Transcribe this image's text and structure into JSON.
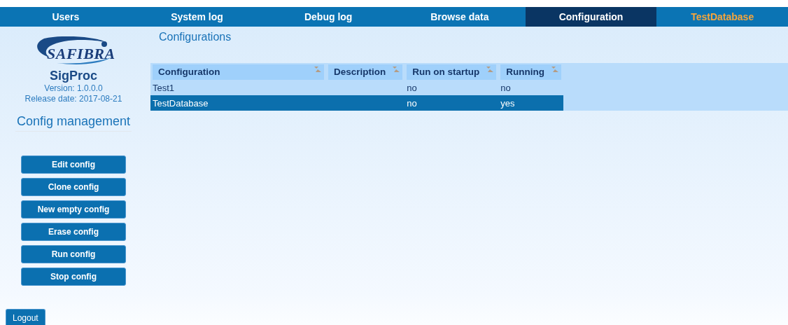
{
  "nav_tabs": [
    {
      "label": "Users",
      "selected": false,
      "kind": "page"
    },
    {
      "label": "System log",
      "selected": false,
      "kind": "page"
    },
    {
      "label": "Debug log",
      "selected": false,
      "kind": "page"
    },
    {
      "label": "Browse data",
      "selected": false,
      "kind": "page"
    },
    {
      "label": "Configuration",
      "selected": true,
      "kind": "page"
    },
    {
      "label": "TestDatabase",
      "selected": false,
      "kind": "highlight"
    }
  ],
  "sidebar": {
    "logo_text": "SAFIBRA",
    "app_name": "SigProc",
    "version": "Version: 1.0.0.0",
    "release_date": "Release date: 2017-08-21",
    "section_title": "Config management",
    "buttons": [
      "Edit config",
      "Clone config",
      "New empty config",
      "Erase config",
      "Run config",
      "Stop config"
    ]
  },
  "content": {
    "title": "Configurations",
    "table": {
      "columns": [
        "Configuration",
        "Description",
        "Run on startup",
        "Running"
      ],
      "rows": [
        {
          "cells": [
            "Test1",
            "",
            "no",
            "no"
          ],
          "selected": false
        },
        {
          "cells": [
            "TestDatabase",
            "",
            "no",
            "yes"
          ],
          "selected": true
        }
      ]
    }
  },
  "logout_button": "Logout"
}
